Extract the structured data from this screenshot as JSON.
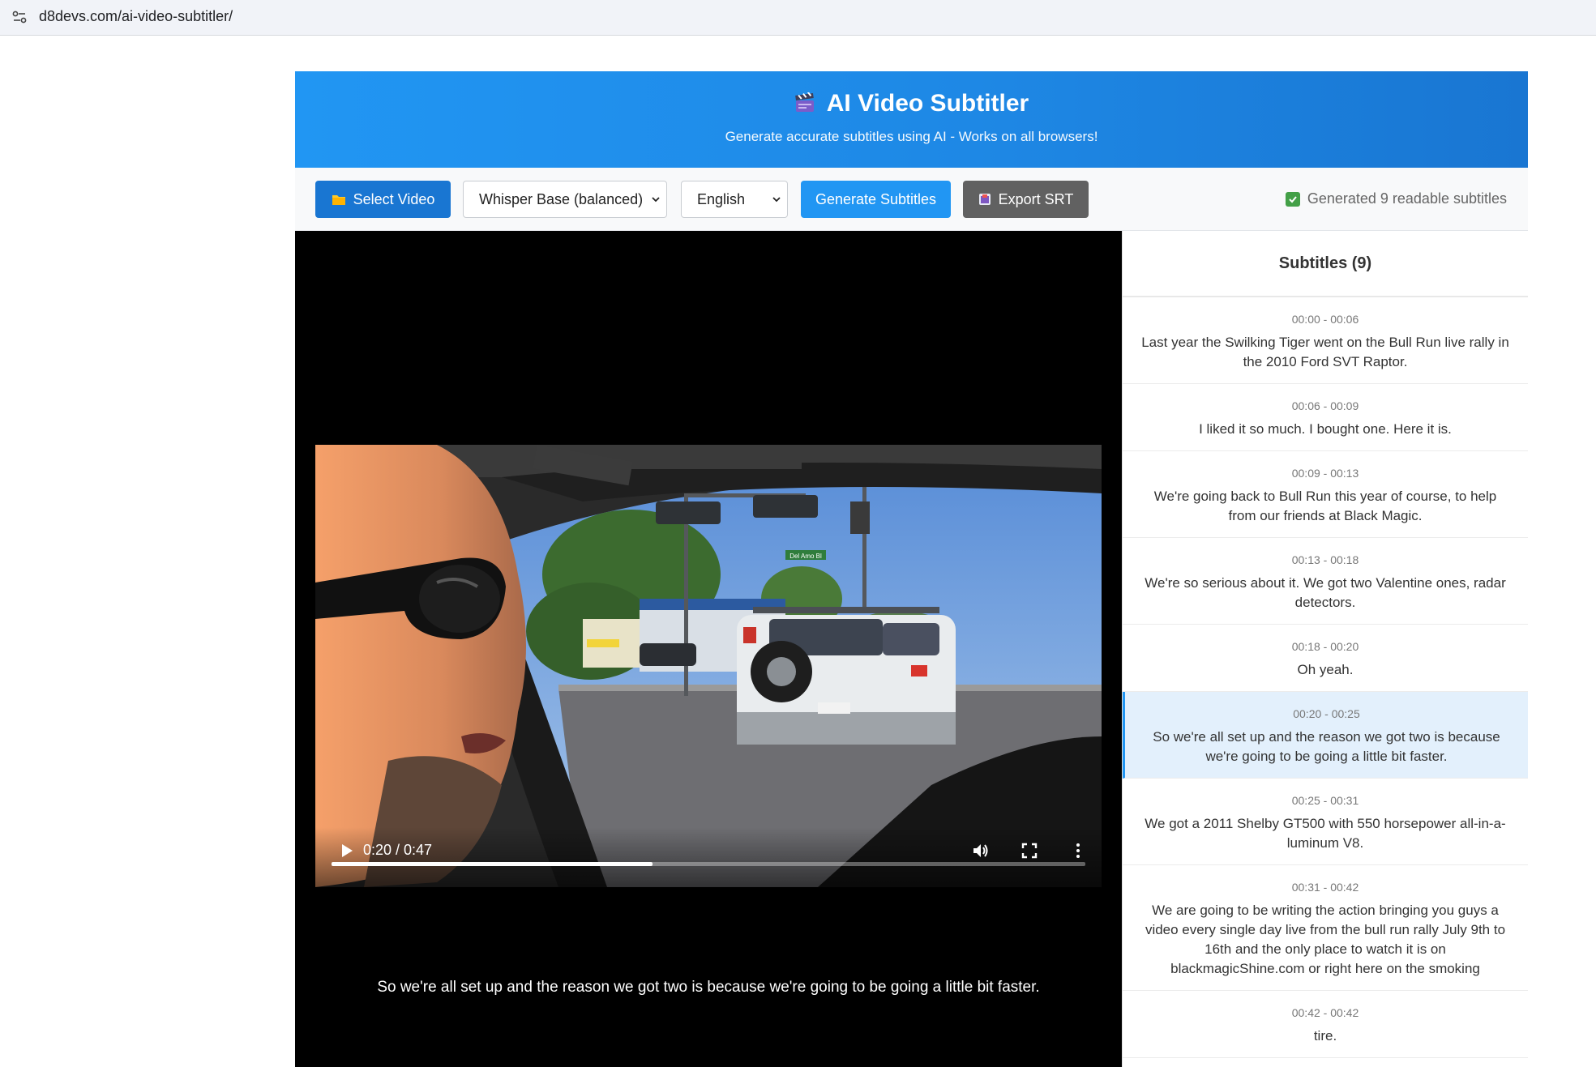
{
  "browser": {
    "url": "d8devs.com/ai-video-subtitler/"
  },
  "header": {
    "title": "AI Video Subtitler",
    "subtitle": "Generate accurate subtitles using AI - Works on all browsers!"
  },
  "toolbar": {
    "select_video_label": "Select Video",
    "model_selected": "Whisper Base (balanced)",
    "language_selected": "English",
    "generate_label": "Generate Subtitles",
    "export_label": "Export SRT",
    "status_text": "Generated 9 readable subtitles"
  },
  "player": {
    "time": "0:20 / 0:47",
    "progress": 0.4255,
    "caption": "So we're all set up and the reason we got two is because we're going to be going a little bit faster.",
    "street_sign": "Del Amo Bl"
  },
  "subtitles_panel": {
    "title": "Subtitles (9)",
    "active_index": 5,
    "items": [
      {
        "time": "00:00 - 00:06",
        "text": "Last year the Swilking Tiger went on the Bull Run live rally in the 2010 Ford SVT Raptor."
      },
      {
        "time": "00:06 - 00:09",
        "text": "I liked it so much. I bought one. Here it is."
      },
      {
        "time": "00:09 - 00:13",
        "text": "We're going back to Bull Run this year of course, to help from our friends at Black Magic."
      },
      {
        "time": "00:13 - 00:18",
        "text": "We're so serious about it. We got two Valentine ones, radar detectors."
      },
      {
        "time": "00:18 - 00:20",
        "text": "Oh yeah."
      },
      {
        "time": "00:20 - 00:25",
        "text": "So we're all set up and the reason we got two is because we're going to be going a little bit faster."
      },
      {
        "time": "00:25 - 00:31",
        "text": "We got a 2011 Shelby GT500 with 550 horsepower all-in-a-luminum V8."
      },
      {
        "time": "00:31 - 00:42",
        "text": "We are going to be writing the action bringing you guys a video every single day live from the bull run rally July 9th to 16th and the only place to watch it is on blackmagicShine.com or right here on the smoking"
      },
      {
        "time": "00:42 - 00:42",
        "text": "tire."
      }
    ]
  },
  "colors": {
    "header_blue": "#2196f3",
    "select_button": "#1976d2",
    "generate_button": "#2196f3",
    "export_button": "#616161",
    "active_item_bg": "#e3f0fc",
    "status_check": "#43a047"
  },
  "icons": {
    "site_info": "tune-icon",
    "title": "clapperboard-icon",
    "select_video": "folder-icon",
    "export": "package-icon",
    "status": "check-box-icon",
    "play": "play-icon",
    "volume": "volume-icon",
    "fullscreen": "fullscreen-icon",
    "more": "more-vert-icon"
  }
}
